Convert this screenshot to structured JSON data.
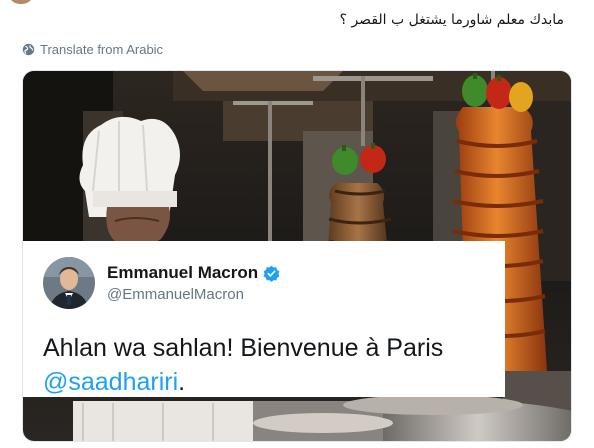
{
  "tweet": {
    "text": "مابدك معلم شاورما يشتغل ب القصر ؟",
    "translate_label": "Translate from Arabic"
  },
  "quoted_tweet": {
    "display_name": "Emmanuel Macron",
    "handle": "@EmmanuelMacron",
    "text": "Ahlan wa sahlan! Bienvenue à Paris",
    "mention": "@saadhariri",
    "mention_suffix": "."
  },
  "icons": [
    "globe-icon",
    "verified-icon"
  ],
  "colors": {
    "link_blue": "#1da1f2",
    "secondary_text": "#657786",
    "primary_text": "#14171a"
  }
}
